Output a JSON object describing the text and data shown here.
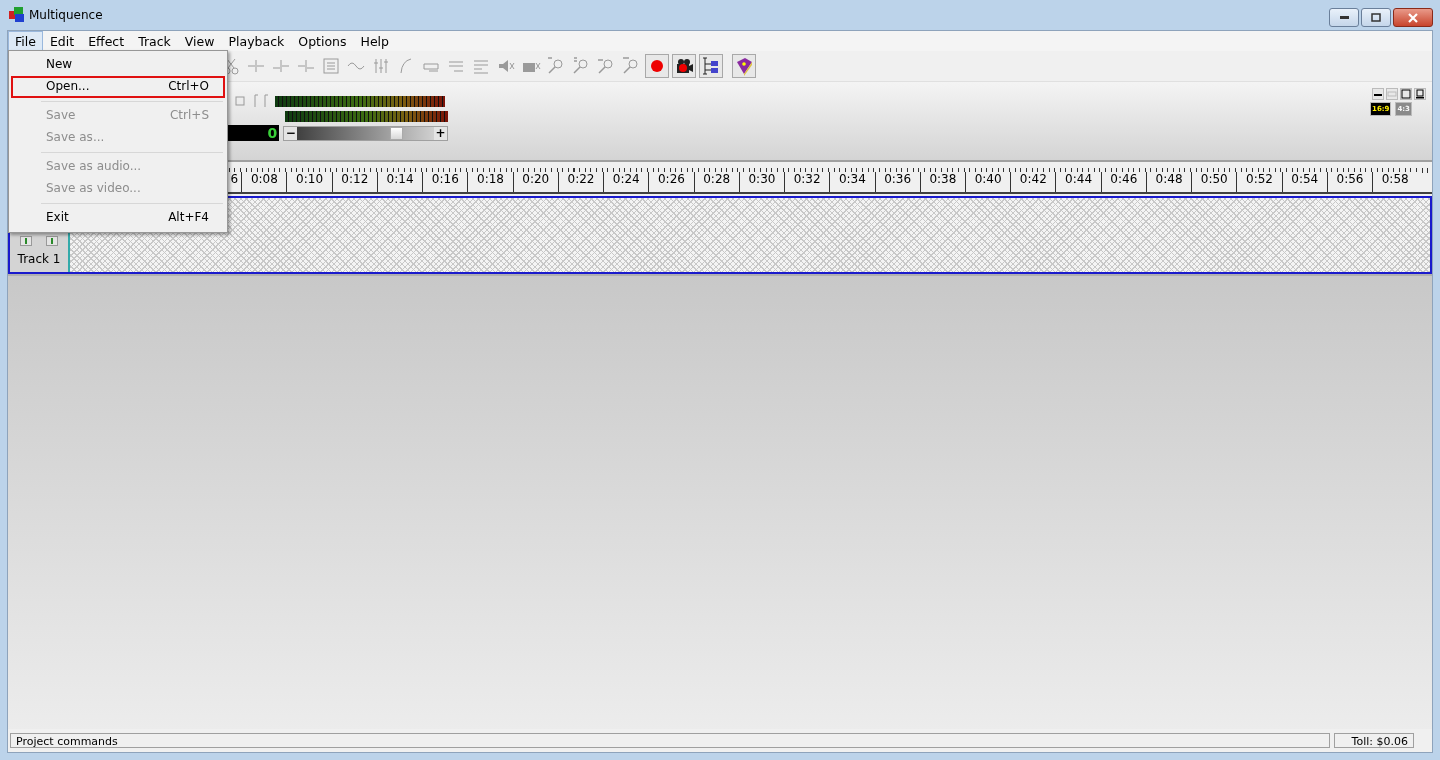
{
  "window": {
    "title": "Multiquence"
  },
  "menu_bar": [
    {
      "label": "File",
      "selected": true
    },
    {
      "label": "Edit",
      "selected": false
    },
    {
      "label": "Effect",
      "selected": false
    },
    {
      "label": "Track",
      "selected": false
    },
    {
      "label": "View",
      "selected": false
    },
    {
      "label": "Playback",
      "selected": false
    },
    {
      "label": "Options",
      "selected": false
    },
    {
      "label": "Help",
      "selected": false
    }
  ],
  "file_menu": [
    {
      "kind": "item",
      "label": "New",
      "disabled": false,
      "selected": false
    },
    {
      "kind": "item",
      "label": "Open...",
      "shortcut": "Ctrl+O",
      "disabled": false,
      "selected": true
    },
    {
      "kind": "separator"
    },
    {
      "kind": "item",
      "label": "Save",
      "shortcut": "Ctrl+S",
      "disabled": true,
      "selected": false
    },
    {
      "kind": "item",
      "label": "Save as...",
      "disabled": true,
      "selected": false
    },
    {
      "kind": "separator"
    },
    {
      "kind": "item",
      "label": "Save as audio...",
      "disabled": true,
      "selected": false
    },
    {
      "kind": "item",
      "label": "Save as video...",
      "disabled": true,
      "selected": false
    },
    {
      "kind": "separator"
    },
    {
      "kind": "item",
      "label": "Exit",
      "shortcut": "Alt+F4",
      "disabled": false,
      "selected": false
    }
  ],
  "transport": {
    "counter": "0",
    "volume": {
      "level": 0.72,
      "minus": "−",
      "plus": "+"
    }
  },
  "aspect_buttons": [
    {
      "label": "16:9",
      "selected": true
    },
    {
      "label": "4:3",
      "selected": false
    }
  ],
  "ruler": {
    "ticks": [
      "6",
      "0:08",
      "0:10",
      "0:12",
      "0:14",
      "0:16",
      "0:18",
      "0:20",
      "0:22",
      "0:24",
      "0:26",
      "0:28",
      "0:30",
      "0:32",
      "0:34",
      "0:36",
      "0:38",
      "0:40",
      "0:42",
      "0:44",
      "0:46",
      "0:48",
      "0:50",
      "0:52",
      "0:54",
      "0:56",
      "0:58"
    ]
  },
  "tracks": [
    {
      "name": "Track 1",
      "selected": true
    }
  ],
  "status_bar": {
    "message": "Project commands",
    "toll": "Toll: $0.06"
  }
}
